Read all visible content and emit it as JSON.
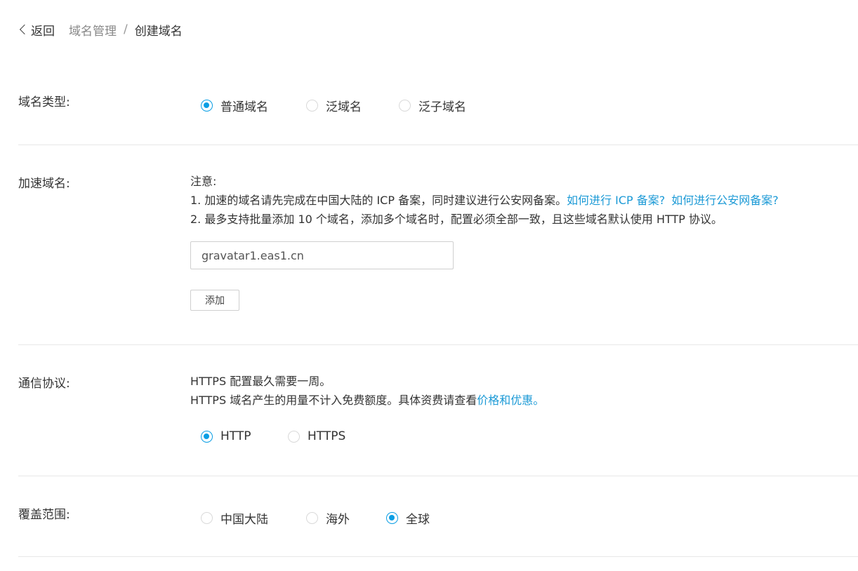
{
  "breadcrumb": {
    "back_label": "返回",
    "parent": "域名管理",
    "separator": "/",
    "current": "创建域名"
  },
  "domain_type": {
    "label": "域名类型:",
    "options": [
      {
        "label": "普通域名",
        "checked": true
      },
      {
        "label": "泛域名",
        "checked": false
      },
      {
        "label": "泛子域名",
        "checked": false
      }
    ]
  },
  "accelerate_domain": {
    "label": "加速域名:",
    "note_title": "注意:",
    "note1_text": "1. 加速的域名请先完成在中国大陆的 ICP 备案，同时建议进行公安网备案。",
    "note1_link1": "如何进行 ICP 备案?",
    "note1_link2": "如何进行公安网备案?",
    "note2_text": "2. 最多支持批量添加 10 个域名，添加多个域名时，配置必须全部一致，且这些域名默认使用 HTTP 协议。",
    "input_value": "gravatar1.eas1.cn",
    "add_button": "添加"
  },
  "protocol": {
    "label": "通信协议:",
    "line1": "HTTPS 配置最久需要一周。",
    "line2_text": "HTTPS 域名产生的用量不计入免费额度。具体资费请查看",
    "line2_link": "价格和优惠。",
    "options": [
      {
        "label": "HTTP",
        "checked": true
      },
      {
        "label": "HTTPS",
        "checked": false
      }
    ]
  },
  "coverage": {
    "label": "覆盖范围:",
    "options": [
      {
        "label": "中国大陆",
        "checked": false
      },
      {
        "label": "海外",
        "checked": false
      },
      {
        "label": "全球",
        "checked": true
      }
    ]
  },
  "colors": {
    "accent": "#0a9ee4",
    "link": "#1c9ad6",
    "divider": "#e8e8e8"
  }
}
